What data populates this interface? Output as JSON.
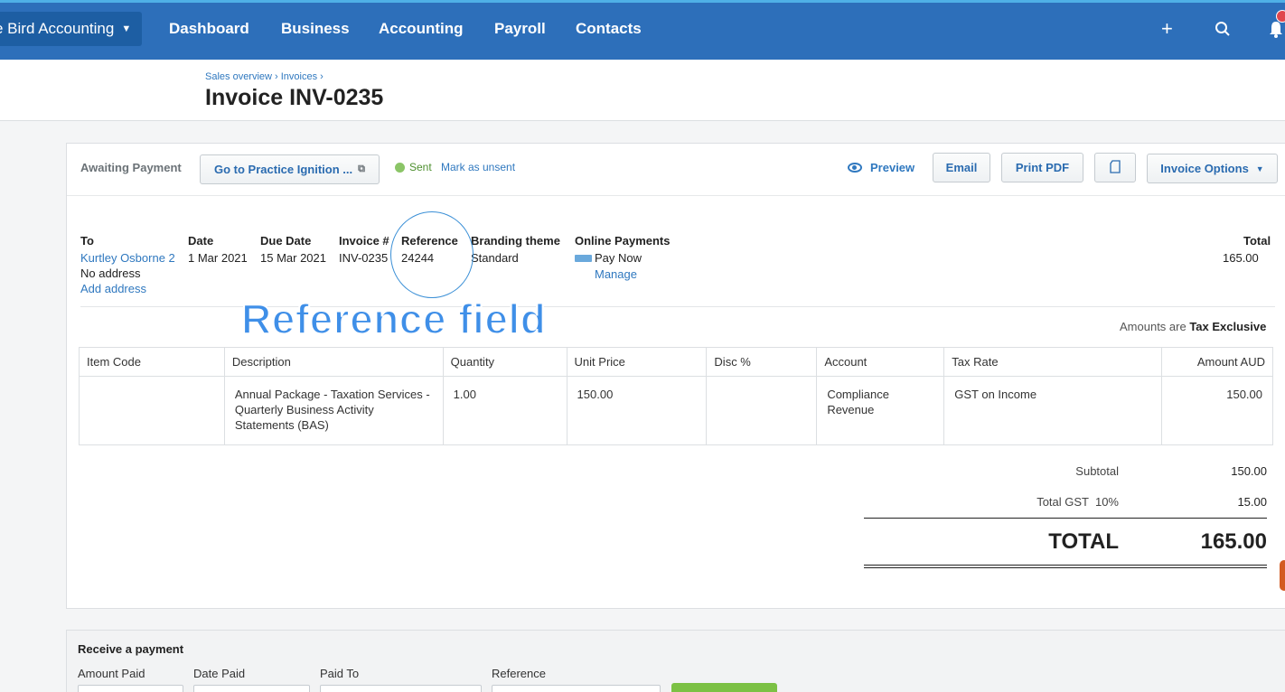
{
  "nav": {
    "org": "e Bird Accounting",
    "items": [
      "Dashboard",
      "Business",
      "Accounting",
      "Payroll",
      "Contacts"
    ],
    "icons": {
      "add": "plus-icon",
      "search": "search-icon",
      "notifications": "bell-icon"
    }
  },
  "header": {
    "breadcrumb": "Sales overview › Invoices ›",
    "title": "Invoice INV-0235"
  },
  "toolbar": {
    "status": "Awaiting Payment",
    "practice_ignition": "Go to Practice Ignition ...",
    "sent": "Sent",
    "mark_unsent": "Mark as unsent",
    "preview": "Preview",
    "email": "Email",
    "print_pdf": "Print PDF",
    "invoice_options": "Invoice Options"
  },
  "invoice": {
    "labels": {
      "to": "To",
      "date": "Date",
      "due_date": "Due Date",
      "invoice_no": "Invoice #",
      "reference": "Reference",
      "branding": "Branding theme",
      "online": "Online Payments",
      "total": "Total"
    },
    "to_name": "Kurtley Osborne 2",
    "no_address": "No address",
    "add_address": "Add address",
    "date": "1 Mar 2021",
    "due_date": "15 Mar 2021",
    "invoice_no": "INV-0235",
    "reference": "24244",
    "branding": "Standard",
    "pay_now": "Pay Now",
    "manage": "Manage",
    "total": "165.00",
    "amounts_prefix": "Amounts are",
    "amounts_mode": "Tax Exclusive"
  },
  "table": {
    "headers": [
      "Item Code",
      "Description",
      "Quantity",
      "Unit Price",
      "Disc %",
      "Account",
      "Tax Rate",
      "Amount AUD"
    ],
    "row": {
      "item_code": "",
      "description": "Annual Package - Taxation Services - Quarterly Business Activity Statements (BAS)",
      "quantity": "1.00",
      "unit_price": "150.00",
      "disc": "",
      "account": "Compliance Revenue",
      "tax_rate": "GST on Income",
      "amount": "150.00"
    }
  },
  "totals": {
    "subtotal_label": "Subtotal",
    "subtotal": "150.00",
    "gst_label": "Total GST  10%",
    "gst": "15.00",
    "total_label": "TOTAL",
    "total": "165.00"
  },
  "annotation": {
    "text": "Reference field"
  },
  "payment": {
    "title": "Receive a payment",
    "amount_paid": "Amount Paid",
    "date_paid": "Date Paid",
    "paid_to": "Paid To",
    "reference": "Reference"
  },
  "colors": {
    "nav": "#2d6fba",
    "link": "#2f78bf",
    "annotation": "#3f8fe8",
    "pay_button": "#7cc144"
  }
}
